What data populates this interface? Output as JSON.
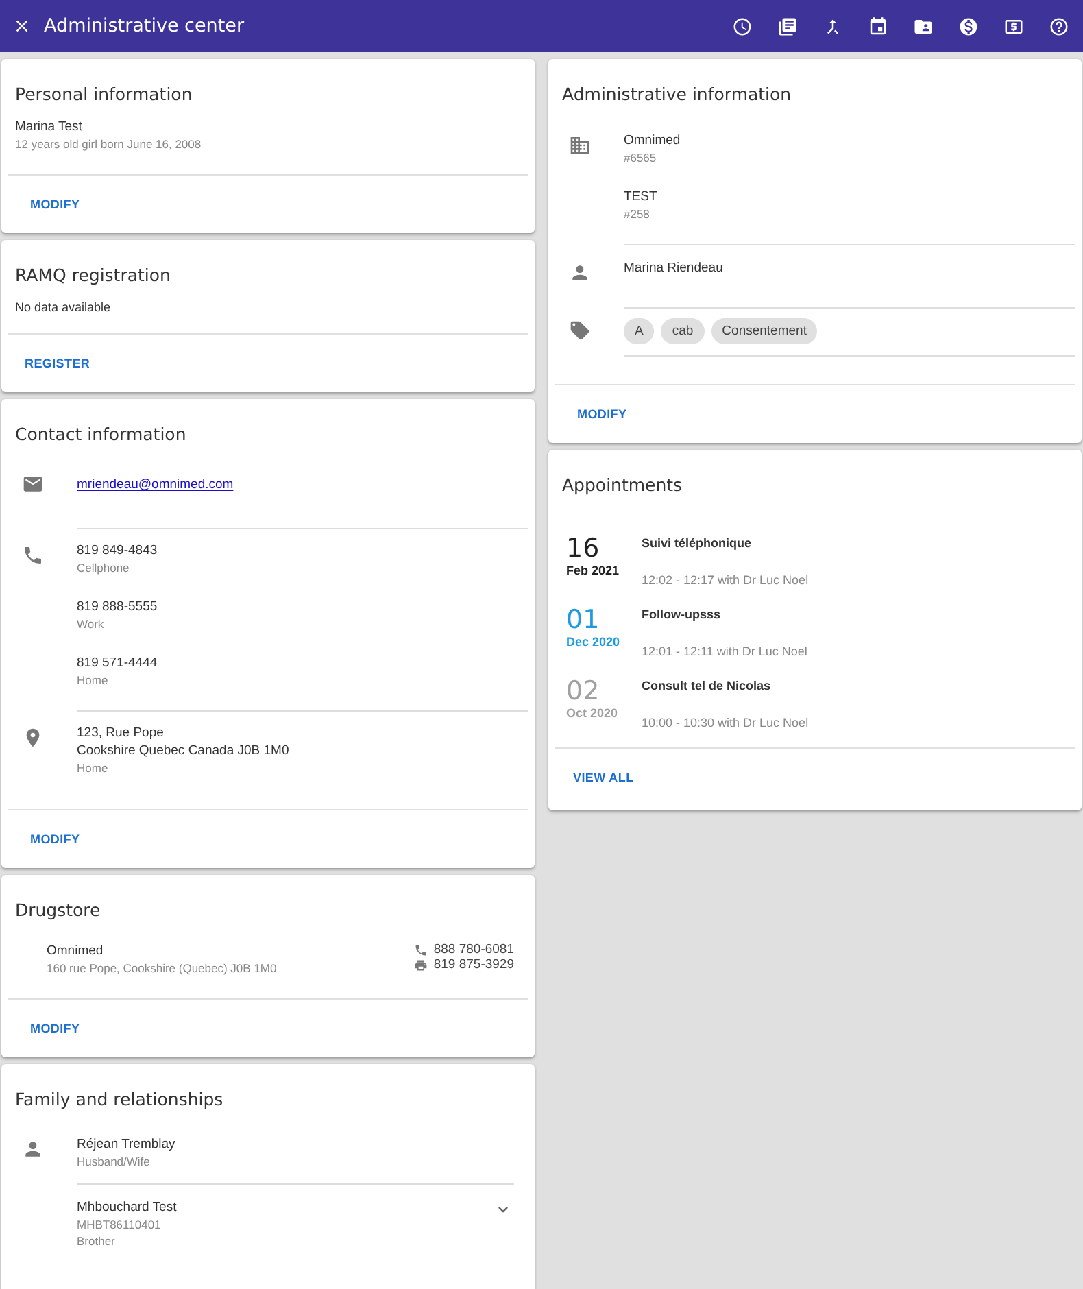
{
  "header": {
    "title": "Administrative center"
  },
  "personal": {
    "title": "Personal information",
    "name": "Marina Test",
    "details": "12 years old girl born June 16, 2008",
    "action": "MODIFY"
  },
  "ramq": {
    "title": "RAMQ registration",
    "message": "No data available",
    "action": "REGISTER"
  },
  "contact": {
    "title": "Contact information",
    "groups": [
      {
        "kind": "email",
        "items": [
          {
            "lines": [
              "mriendeau@omnimed.com"
            ]
          }
        ]
      },
      {
        "kind": "phone",
        "items": [
          {
            "lines": [
              "819 849-4843"
            ],
            "label": "Cellphone"
          },
          {
            "lines": [
              "819 888-5555"
            ],
            "label": "Work"
          },
          {
            "lines": [
              "819 571-4444"
            ],
            "label": "Home"
          }
        ]
      },
      {
        "kind": "address",
        "items": [
          {
            "lines": [
              "123, Rue Pope",
              "Cookshire Quebec Canada J0B 1M0"
            ],
            "label": "Home"
          }
        ]
      }
    ],
    "action": "MODIFY"
  },
  "drugstore": {
    "title": "Drugstore",
    "name": "Omnimed",
    "address": "160 rue Pope, Cookshire (Quebec) J0B 1M0",
    "phone": "888 780-6081",
    "fax": "819 875-3929",
    "action": "MODIFY"
  },
  "family": {
    "title": "Family and relationships",
    "members": [
      {
        "name": "Réjean Tremblay",
        "relation": "Husband/Wife",
        "expandable": false
      },
      {
        "name": "Mhbouchard Test",
        "code": "MHBT86110401",
        "relation": "Brother",
        "expandable": true
      }
    ]
  },
  "administrative": {
    "title": "Administrative information",
    "groups": [
      {
        "kind": "organization",
        "items": [
          {
            "name": "Omnimed",
            "number": "#6565"
          },
          {
            "name": "TEST",
            "number": "#258"
          }
        ]
      },
      {
        "kind": "person",
        "items": [
          {
            "name": "Marina Riendeau"
          }
        ]
      },
      {
        "kind": "tags",
        "tags": [
          "A",
          "cab",
          "Consentement"
        ]
      }
    ],
    "action": "MODIFY"
  },
  "appointments": {
    "title": "Appointments",
    "items": [
      {
        "day": "16",
        "month": "Feb 2021",
        "title": "Suivi téléphonique",
        "time": "12:02 - 12:17 with Dr Luc Noel",
        "color": "#212121"
      },
      {
        "day": "01",
        "month": "Dec 2020",
        "title": "Follow-upsss",
        "time": "12:01 - 12:11 with Dr Luc Noel",
        "color": "#1e9be0"
      },
      {
        "day": "02",
        "month": "Oct 2020",
        "title": "Consult tel de Nicolas",
        "time": "10:00 - 10:30 with Dr Luc Noel",
        "color": "#a0a0a0"
      }
    ],
    "action": "VIEW ALL"
  }
}
